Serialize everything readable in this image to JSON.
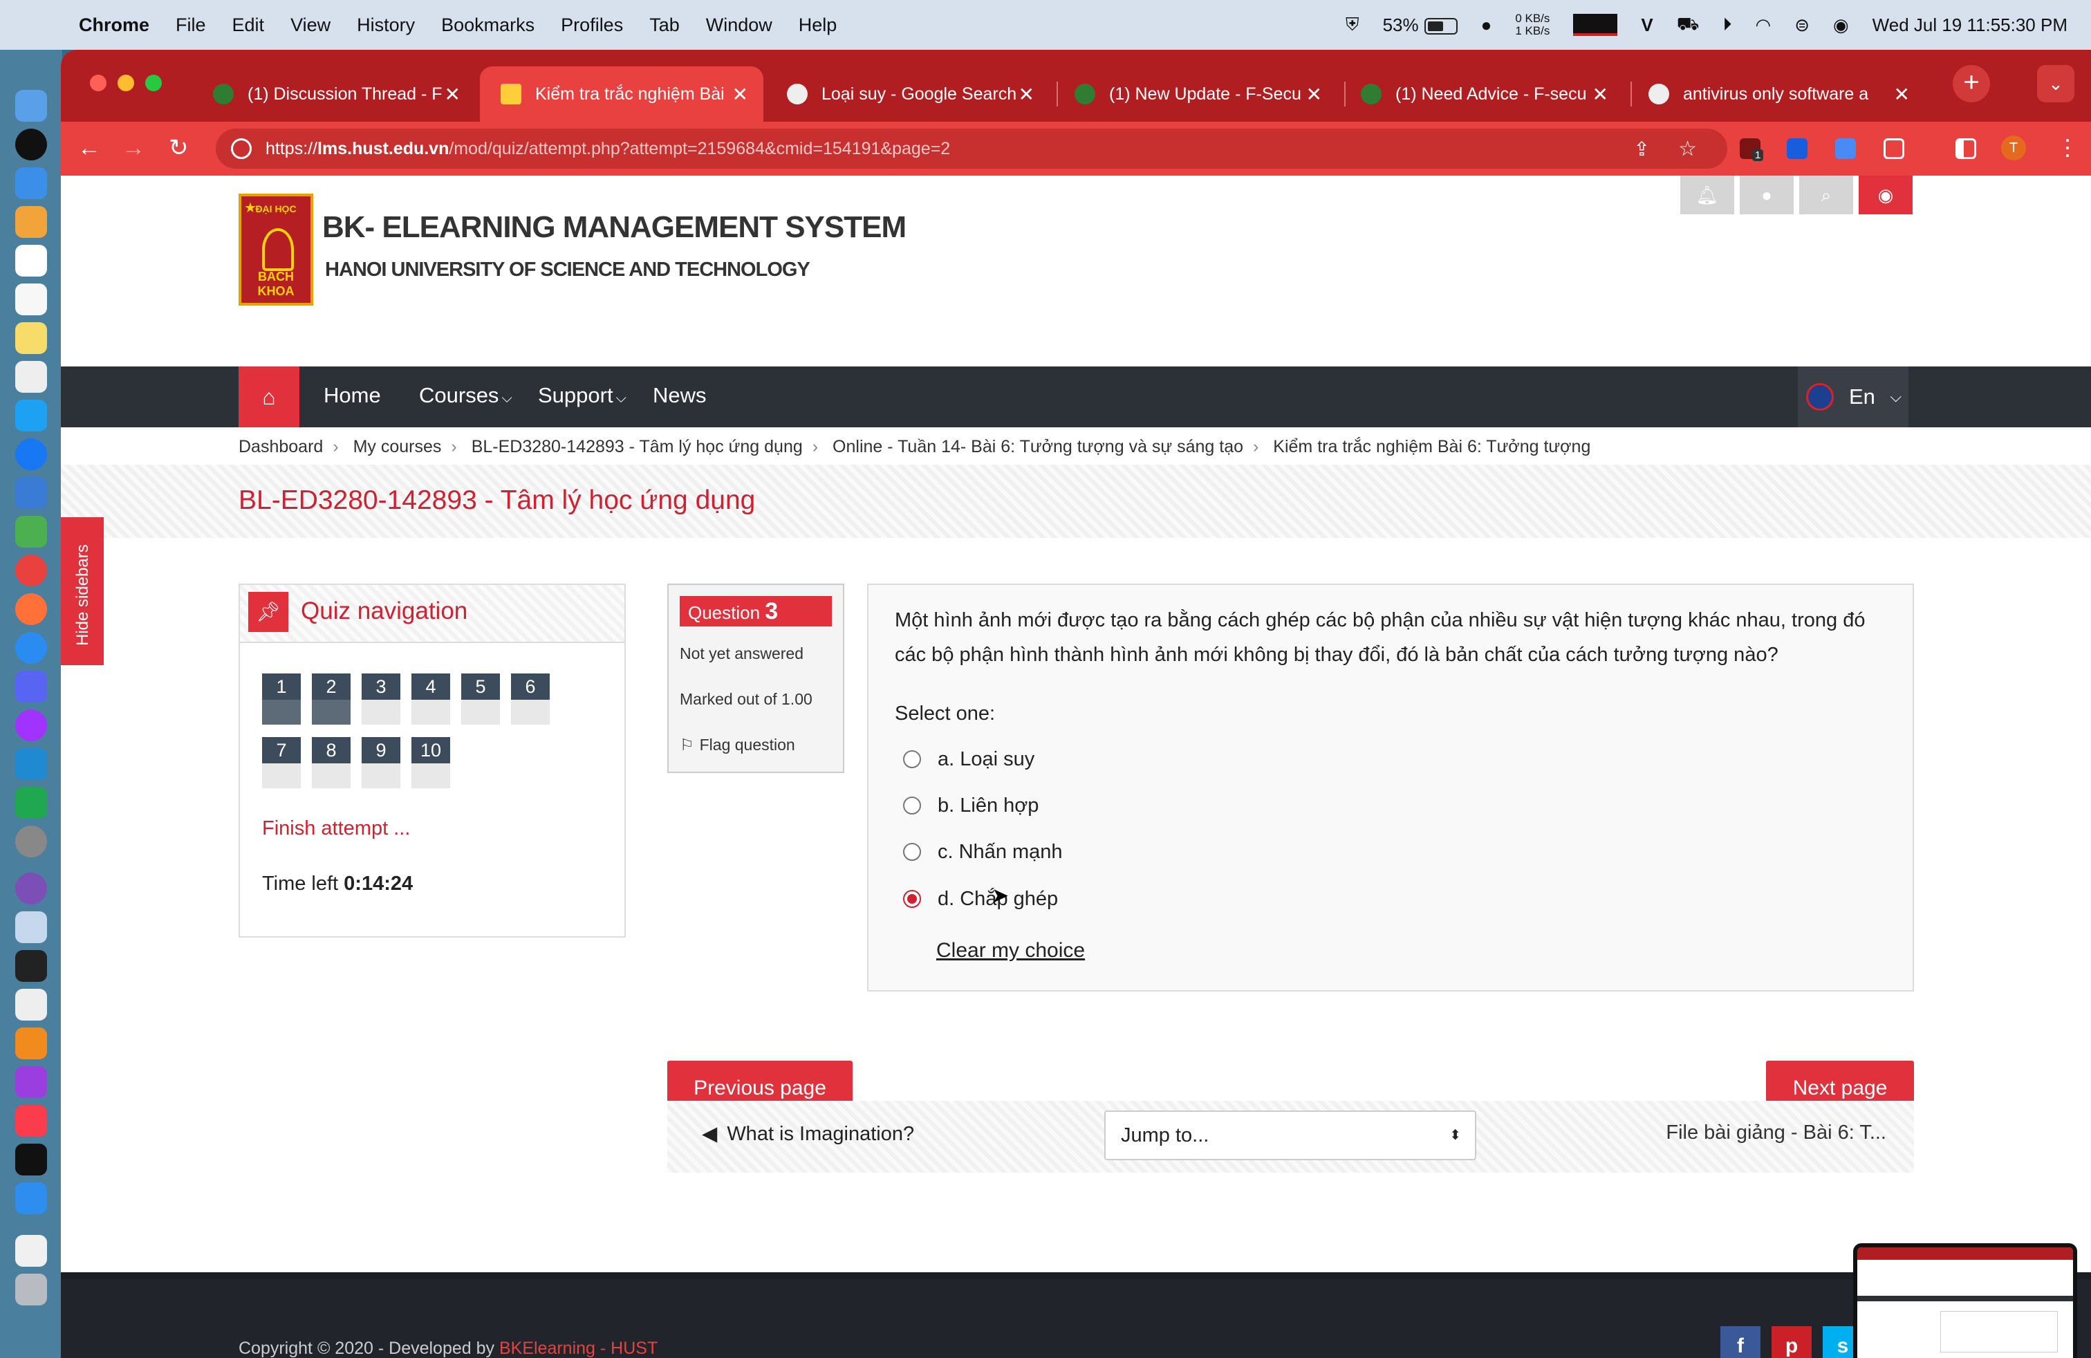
{
  "menubar": {
    "app": "Chrome",
    "items": [
      "File",
      "Edit",
      "View",
      "History",
      "Bookmarks",
      "Profiles",
      "Tab",
      "Window",
      "Help"
    ],
    "battery": "53%",
    "net_down": "0 KB/s",
    "net_up": "1 KB/s",
    "clock": "Wed Jul 19  11:55:30 PM"
  },
  "tabs": [
    {
      "title": "(1) Discussion Thread - F"
    },
    {
      "title": "Kiểm tra trắc nghiệm Bài"
    },
    {
      "title": "Loại suy - Google Search"
    },
    {
      "title": "(1) New Update - F-Secu"
    },
    {
      "title": "(1) Need Advice - F-secu"
    },
    {
      "title": "antivirus only software a"
    }
  ],
  "address": {
    "scheme": "https://",
    "host": "lms.hust.edu.vn",
    "path": "/mod/quiz/attempt.php?attempt=2159684&cmid=154191&page=2"
  },
  "toolbar": {
    "extension_badge": "1",
    "profile_initial": "T"
  },
  "site": {
    "logo_top": "ĐẠI HỌC",
    "logo_text": "BÁCH KHOA",
    "title": "BK- ELEARNING MANAGEMENT SYSTEM",
    "subtitle": "HANOI UNIVERSITY OF SCIENCE AND TECHNOLOGY"
  },
  "nav": {
    "items": [
      "Home",
      "Courses",
      "Support",
      "News"
    ],
    "language": "En"
  },
  "breadcrumb": [
    "Dashboard",
    "My courses",
    "BL-ED3280-142893 - Tâm lý học ứng dụng",
    "Online - Tuần 14- Bài 6: Tưởng tượng và sự sáng tạo",
    "Kiểm tra trắc nghiệm Bài 6: Tưởng tượng"
  ],
  "course_title": "BL-ED3280-142893 - Tâm lý học ứng dụng",
  "hide_sidebars": "Hide sidebars",
  "quiz_nav": {
    "title": "Quiz navigation",
    "buttons": [
      "1",
      "2",
      "3",
      "4",
      "5",
      "6",
      "7",
      "8",
      "9",
      "10"
    ],
    "finish": "Finish attempt ...",
    "time_label": "Time left ",
    "time_value": "0:14:24"
  },
  "question_info": {
    "label": "Question ",
    "number": "3",
    "state": "Not yet answered",
    "marked": "Marked out of 1.00",
    "flag": "Flag question"
  },
  "question": {
    "text": "Một hình ảnh mới được tạo ra bằng cách ghép các bộ phận của nhiều sự vật hiện tượng khác nhau, trong đó các bộ phận hình thành hình ảnh mới không bị thay đổi, đó là bản chất của cách tưởng tượng nào?",
    "prompt": "Select one:",
    "options": [
      {
        "label": "a. Loại suy",
        "selected": false
      },
      {
        "label": "b. Liên hợp",
        "selected": false
      },
      {
        "label": "c. Nhấn mạnh",
        "selected": false
      },
      {
        "label": "d. Chắp ghép",
        "selected": true
      }
    ],
    "clear": "Clear my choice"
  },
  "buttons": {
    "prev": "Previous page",
    "next": "Next page"
  },
  "activity_nav": {
    "prev": "What is Imagination?",
    "jump": "Jump to...",
    "next": "File bài giảng - Bài 6: T..."
  },
  "footer": {
    "copyright": "Copyright © 2020 - Developed by ",
    "developer": "BKElearning - HUST",
    "social": [
      "f",
      "p",
      "s"
    ]
  },
  "colors": {
    "brand_red": "#e0313d",
    "chrome_red": "#b01e22",
    "navbar": "#2c3037"
  }
}
